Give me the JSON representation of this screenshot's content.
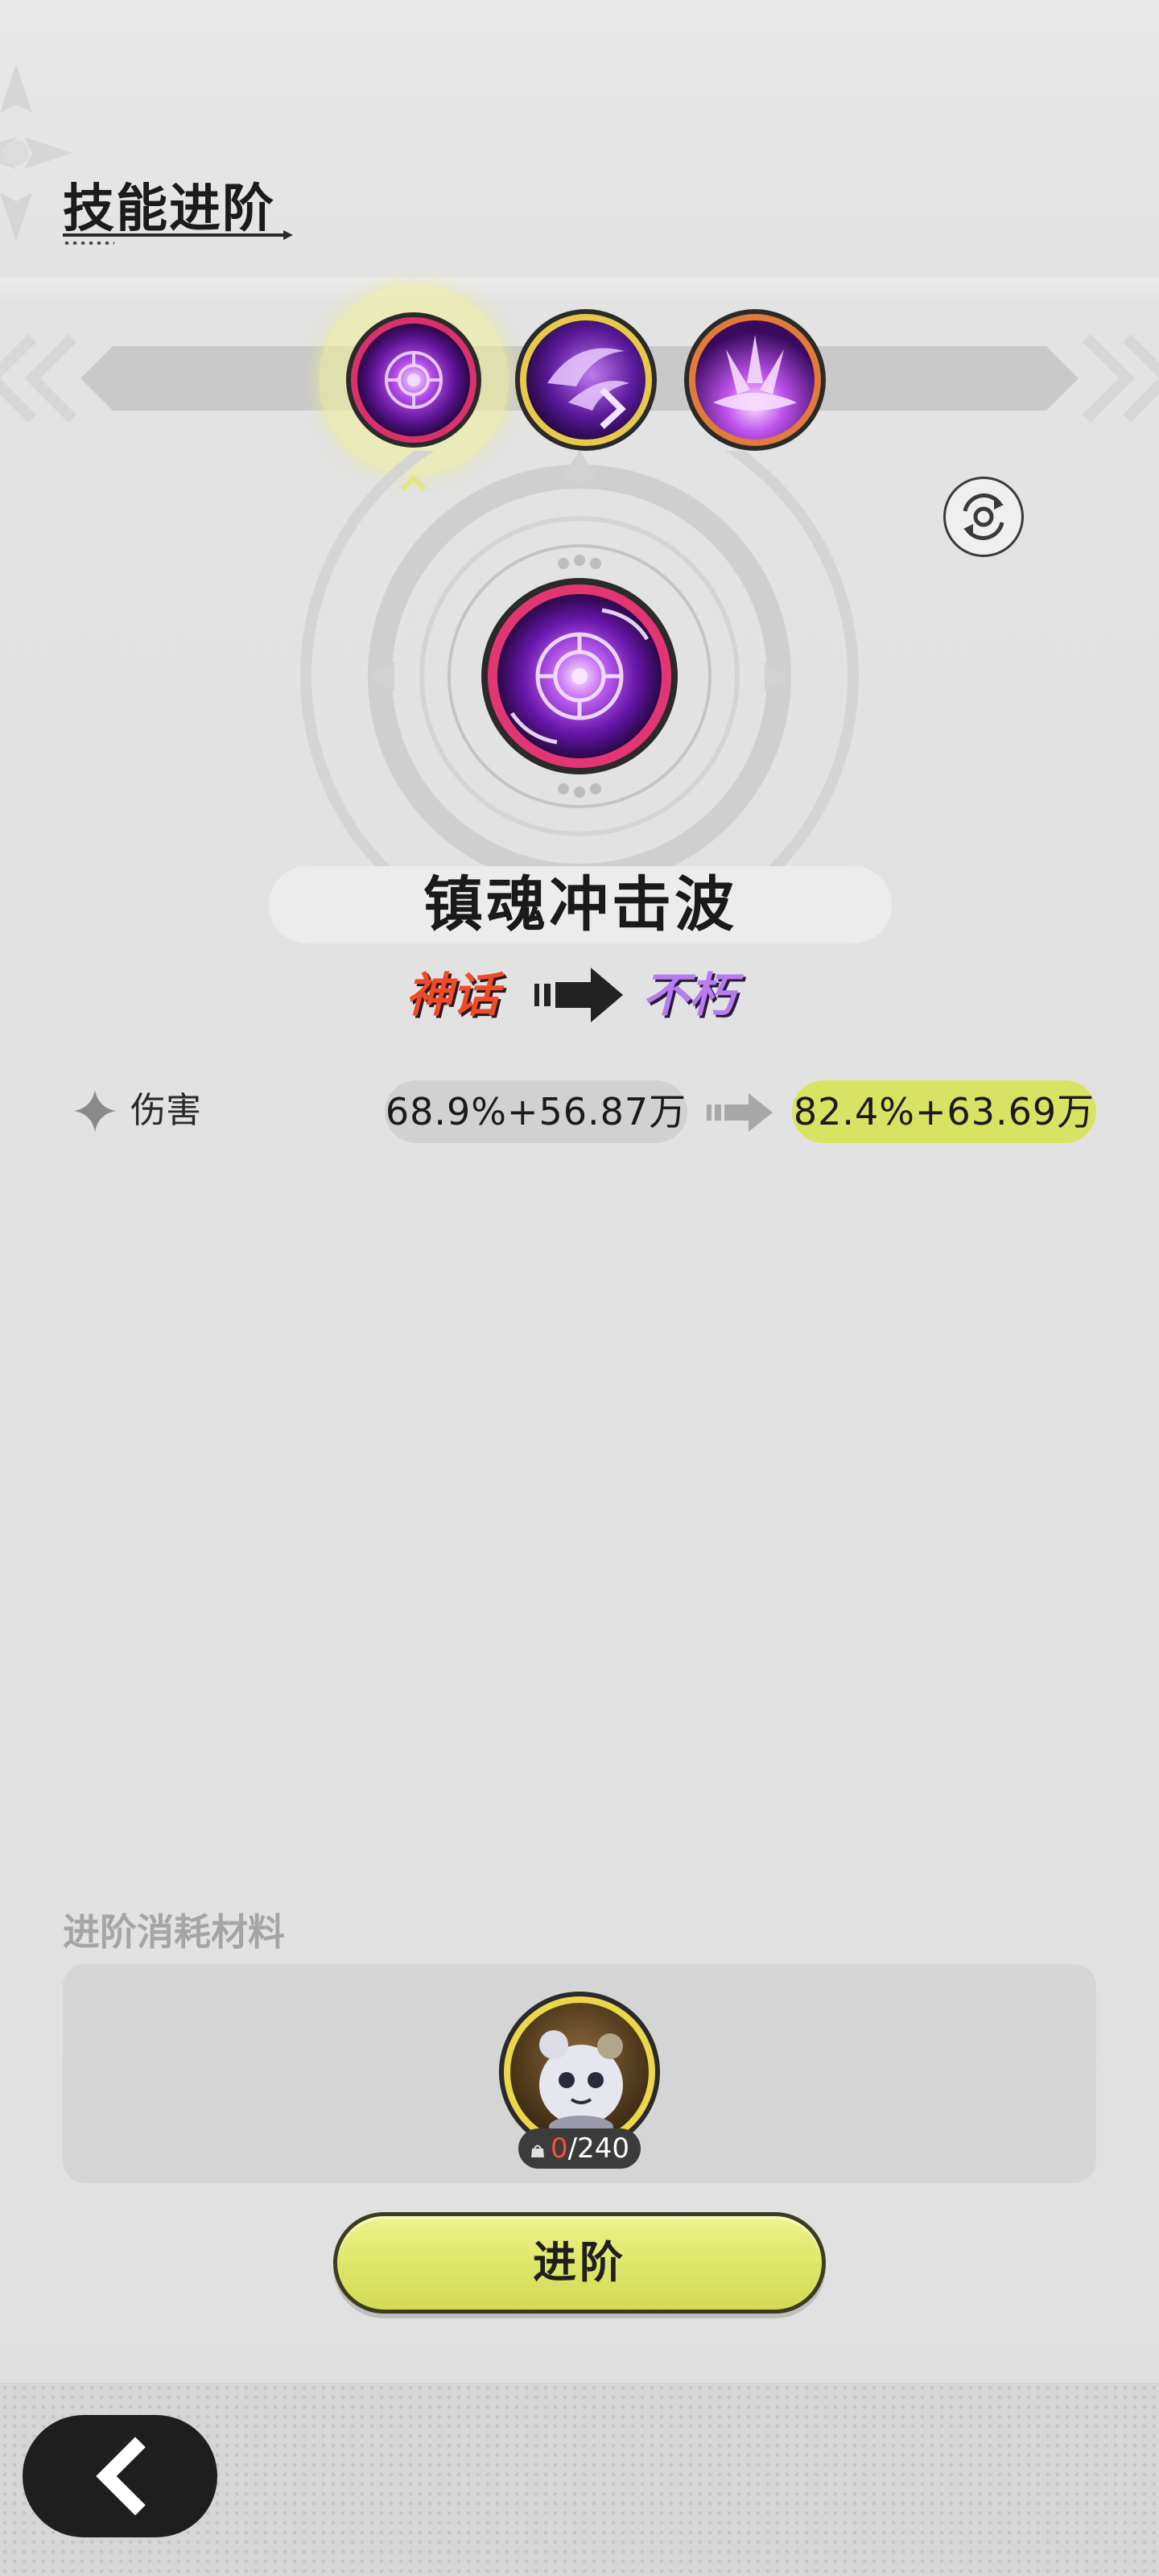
{
  "header": {
    "title": "技能进阶"
  },
  "skill_tabs": [
    {
      "icon": "vortex-skill-icon",
      "selected": true,
      "ring_color": "#d9316a"
    },
    {
      "icon": "claw-skill-icon",
      "selected": false,
      "ring_color": "#e6c94a"
    },
    {
      "icon": "burst-skill-icon",
      "selected": false,
      "ring_color": "#e27b3a"
    }
  ],
  "skill": {
    "name": "镇魂冲击波",
    "tier_from": "神话",
    "tier_to": "不朽"
  },
  "stats": [
    {
      "label": "伤害",
      "current": "68.9%+56.87万",
      "next": "82.4%+63.69万"
    }
  ],
  "materials": {
    "title": "进阶消耗材料",
    "item": {
      "icon": "spirit-creature-icon",
      "owned": "0",
      "required": "/240"
    }
  },
  "actions": {
    "advance_label": "进阶"
  },
  "colors": {
    "accent": "#d9e363",
    "tier_mythic": "#f14a2a",
    "tier_immortal": "#b67cf0",
    "owned_count": "#ff4a3d"
  }
}
